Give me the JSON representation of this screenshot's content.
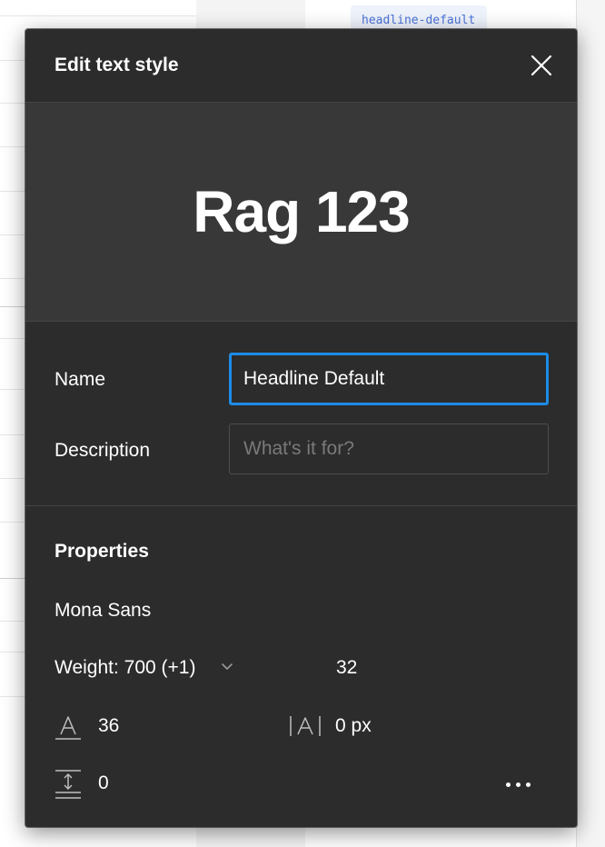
{
  "background": {
    "chip_text": "headline-default"
  },
  "modal": {
    "title": "Edit text style",
    "preview_text": "Rag 123",
    "name": {
      "label": "Name",
      "value": "Headline Default"
    },
    "description": {
      "label": "Description",
      "placeholder": "What's it for?"
    },
    "properties": {
      "title": "Properties",
      "font_family": "Mona Sans",
      "weight": "Weight: 700 (+1)",
      "size": "32",
      "line_height": "36",
      "letter_spacing": "0 px",
      "paragraph_spacing": "0"
    }
  },
  "colors": {
    "modal_bg": "#2c2c2c",
    "preview_bg": "#383838",
    "focus_accent": "#1c8ce6"
  },
  "icons": [
    "close-icon",
    "chevron-down-icon",
    "line-height-icon",
    "letter-spacing-icon",
    "paragraph-spacing-icon",
    "more-icon"
  ]
}
